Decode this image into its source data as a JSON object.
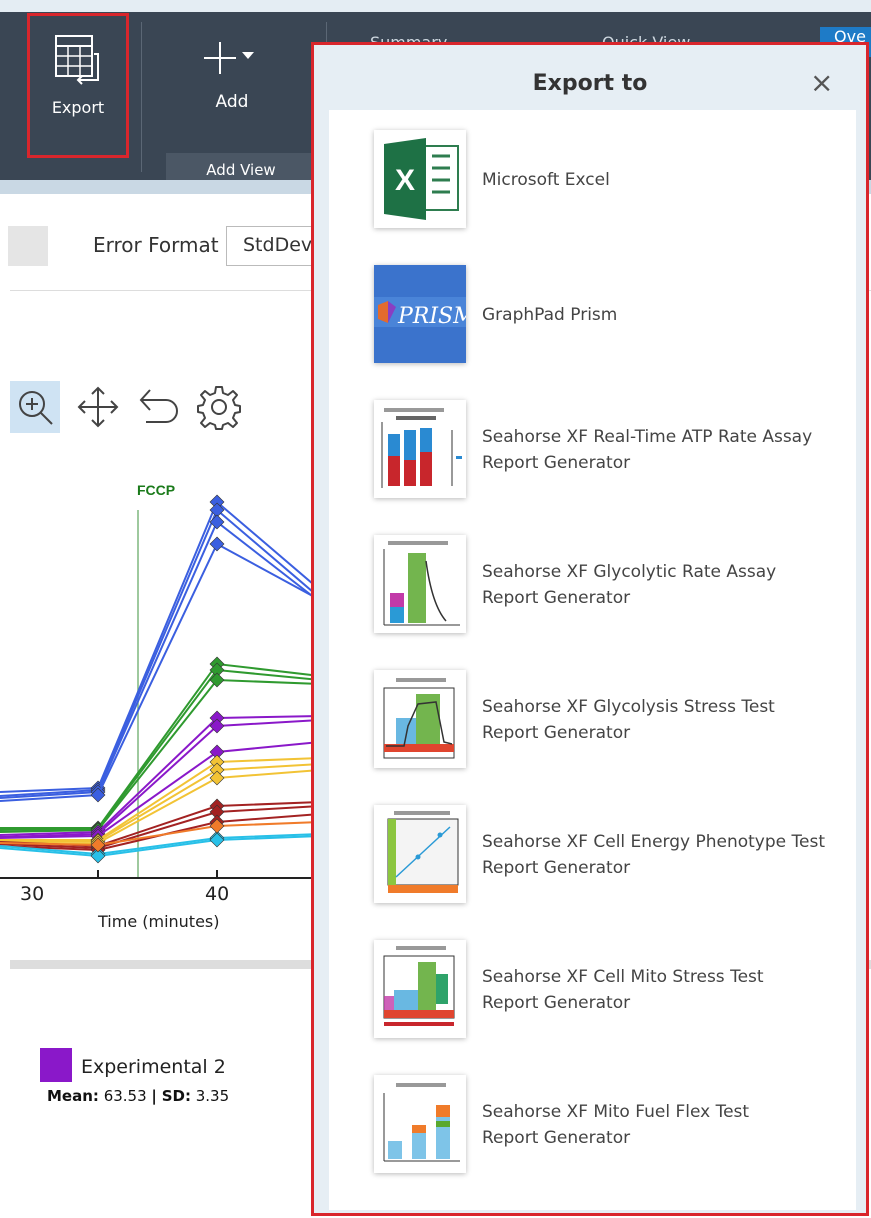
{
  "toolbar": {
    "export_label": "Export",
    "add_label": "Add",
    "add_group_label": "Add View",
    "tabs": [
      "Summary",
      "Quick View",
      "Ove"
    ]
  },
  "controls": {
    "error_format_label": "Error Format",
    "error_format_value": "StdDev"
  },
  "chart": {
    "marker_label": "FCCP",
    "x_ticks": [
      "30",
      "40"
    ],
    "x_axis_label": "Time (minutes)"
  },
  "legend": {
    "name": "Experimental 2",
    "mean_label": "Mean:",
    "mean_value": "63.53",
    "separator": "|",
    "sd_label": "SD:",
    "sd_value": "3.35",
    "color": "#8a18c9"
  },
  "modal": {
    "title": "Export to",
    "close_glyph": "×",
    "items": [
      {
        "line1": "Microsoft Excel",
        "line2": "",
        "icon": "excel-icon"
      },
      {
        "line1": "GraphPad Prism",
        "line2": "",
        "icon": "prism-icon"
      },
      {
        "line1": "Seahorse XF Real-Time ATP Rate Assay",
        "line2": "Report Generator",
        "icon": "atp-rate-report-thumbnail"
      },
      {
        "line1": "Seahorse XF Glycolytic Rate Assay",
        "line2": "Report Generator",
        "icon": "glycolytic-rate-report-thumbnail"
      },
      {
        "line1": "Seahorse XF Glycolysis Stress Test",
        "line2": "Report Generator",
        "icon": "glycolysis-stress-report-thumbnail"
      },
      {
        "line1": "Seahorse XF Cell Energy Phenotype Test",
        "line2": "Report Generator",
        "icon": "cell-energy-report-thumbnail"
      },
      {
        "line1": "Seahorse XF Cell Mito Stress Test",
        "line2": "Report Generator",
        "icon": "mito-stress-report-thumbnail"
      },
      {
        "line1": "Seahorse XF Mito Fuel Flex Test",
        "line2": "Report Generator",
        "icon": "fuel-flex-report-thumbnail"
      }
    ]
  },
  "colors": {
    "highlight_border": "#d9262c",
    "toolbar_bg": "#3a4654",
    "accent_blue": "#1e7bc7"
  }
}
